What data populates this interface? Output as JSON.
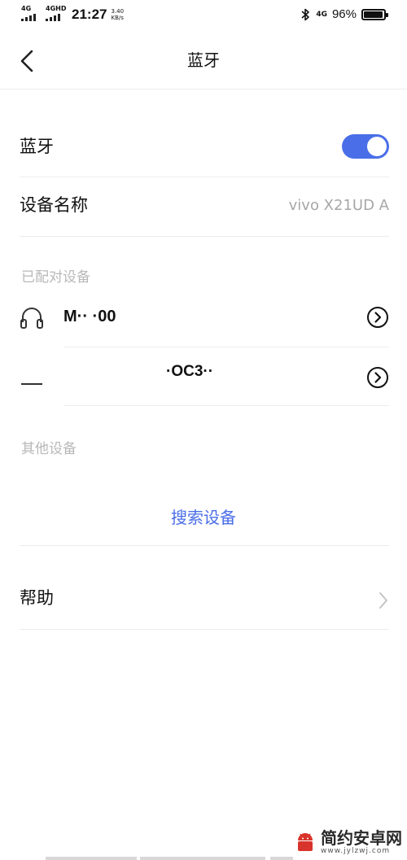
{
  "status_bar": {
    "net1_label": "4G",
    "net2_label": "4GHD",
    "time": "21:27",
    "speed_value": "3.40",
    "speed_unit": "KB/s",
    "network_type": "4G",
    "battery_percent": "96%",
    "battery_level": 0.96
  },
  "header": {
    "title": "蓝牙"
  },
  "bluetooth_row": {
    "label": "蓝牙",
    "enabled": true
  },
  "device_name_row": {
    "label": "设备名称",
    "value": "vivo X21UD A"
  },
  "paired_devices": {
    "section_title": "已配对设备",
    "items": [
      {
        "name": "M·· ·00",
        "icon": "headphones-icon"
      },
      {
        "name": "·OC3··",
        "icon": "device-icon"
      }
    ]
  },
  "other_devices": {
    "section_title": "其他设备",
    "search_label": "搜索设备"
  },
  "help_row": {
    "label": "帮助"
  },
  "watermark": {
    "title": "简约安卓网",
    "url": "www.jylzwj.com"
  },
  "colors": {
    "accent": "#4a6ee8",
    "secondary_text": "#a7a7a7",
    "section_text": "#b8b8b8",
    "divider": "#ececec"
  }
}
